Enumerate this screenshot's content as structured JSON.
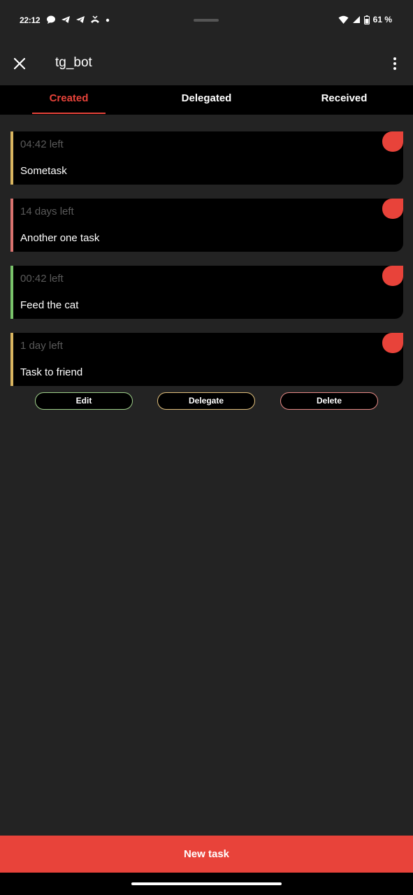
{
  "status_bar": {
    "time": "22:12",
    "battery_text": "61 %",
    "icons": [
      "chat-icon",
      "telegram-icon",
      "telegram-icon",
      "missed-call-icon",
      "dot-icon",
      "wifi-icon",
      "signal-icon",
      "battery-icon"
    ]
  },
  "app_bar": {
    "title": "tg_bot",
    "close_icon": "close-icon",
    "more_icon": "more-vert-icon"
  },
  "tabs": [
    {
      "label": "Created",
      "active": true
    },
    {
      "label": "Delegated",
      "active": false
    },
    {
      "label": "Received",
      "active": false
    }
  ],
  "tasks": [
    {
      "time_left": "04:42 left",
      "title": "Sometask",
      "accent": "#d8b45f"
    },
    {
      "time_left": "14 days left",
      "title": "Another one task",
      "accent": "#d9736f"
    },
    {
      "time_left": "00:42 left",
      "title": "Feed the cat",
      "accent": "#79c36a"
    },
    {
      "time_left": "1 day left",
      "title": "Task to friend",
      "accent": "#d8b45f"
    }
  ],
  "actions": {
    "edit": "Edit",
    "delegate": "Delegate",
    "delete": "Delete"
  },
  "new_task_label": "New task",
  "colors": {
    "accent": "#e8433a",
    "background": "#232323",
    "card": "#000000"
  }
}
